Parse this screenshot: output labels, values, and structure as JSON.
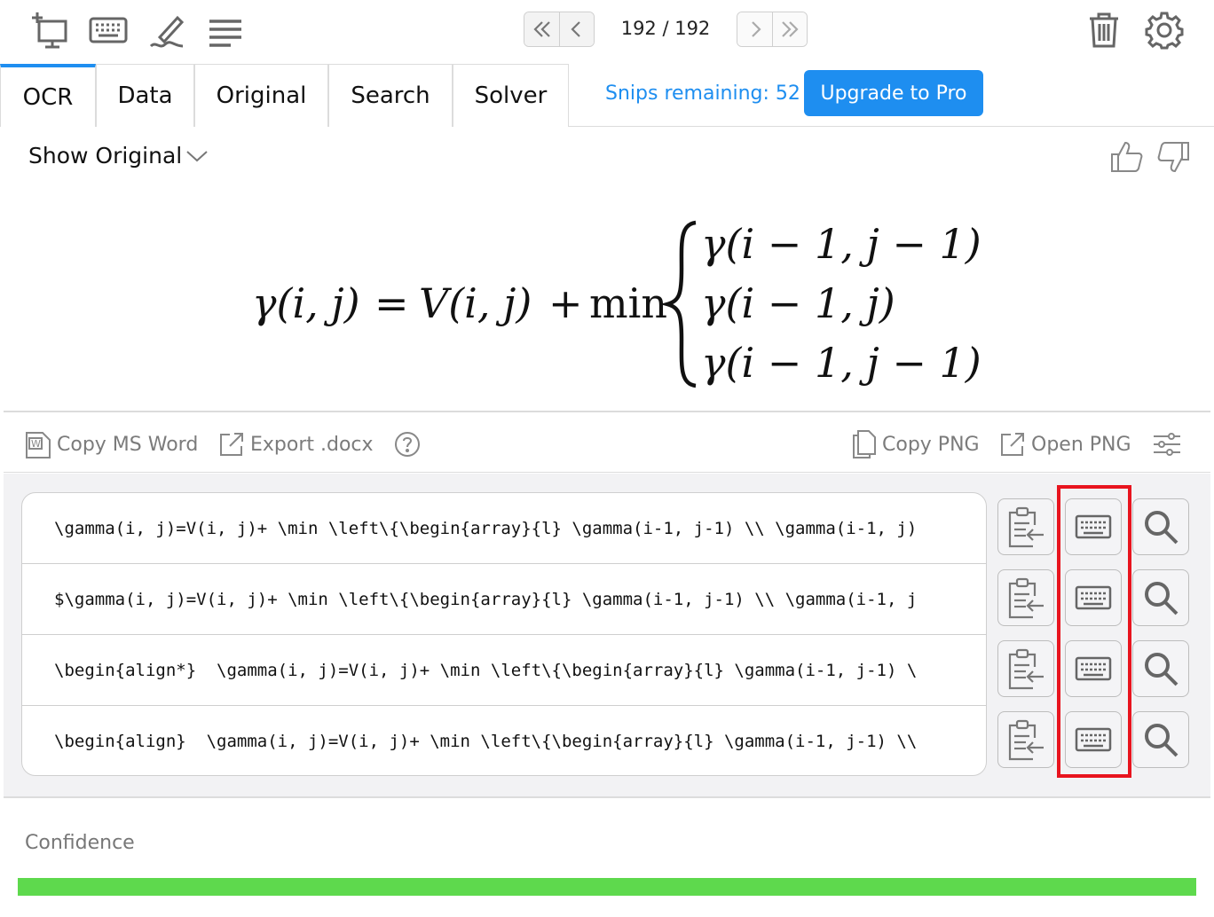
{
  "toolbar": {
    "icons": [
      "new-screenshot-icon",
      "keyboard-icon",
      "handwriting-icon",
      "menu-icon",
      "trash-icon",
      "gear-icon"
    ],
    "page_counter": "192 / 192"
  },
  "tabs": [
    {
      "label": "OCR",
      "active": true
    },
    {
      "label": "Data",
      "active": false
    },
    {
      "label": "Original",
      "active": false
    },
    {
      "label": "Search",
      "active": false
    },
    {
      "label": "Solver",
      "active": false
    }
  ],
  "account": {
    "snips_remaining": "Snips remaining: 52",
    "upgrade_label": "Upgrade to Pro"
  },
  "preview": {
    "show_original_label": "Show Original"
  },
  "actions": {
    "copy_ms_word": "Copy MS Word",
    "export_docx": "Export .docx",
    "copy_png": "Copy PNG",
    "open_png": "Open PNG"
  },
  "results": [
    "\\gamma(i, j)=V(i, j)+ \\min \\left\\{\\begin{array}{l} \\gamma(i-1, j-1) \\\\ \\gamma(i-1, j)",
    "$\\gamma(i, j)=V(i, j)+ \\min \\left\\{\\begin{array}{l} \\gamma(i-1, j-1) \\\\ \\gamma(i-1, j",
    "\\begin{align*}  \\gamma(i, j)=V(i, j)+ \\min \\left\\{\\begin{array}{l} \\gamma(i-1, j-1) \\",
    "\\begin{align}  \\gamma(i, j)=V(i, j)+ \\min \\left\\{\\begin{array}{l} \\gamma(i-1, j-1) \\\\"
  ],
  "confidence": {
    "label": "Confidence",
    "fraction": 1.0,
    "color": "#5ed94d"
  },
  "colors": {
    "accent": "#1e8ef0",
    "highlight": "#e8141e"
  }
}
